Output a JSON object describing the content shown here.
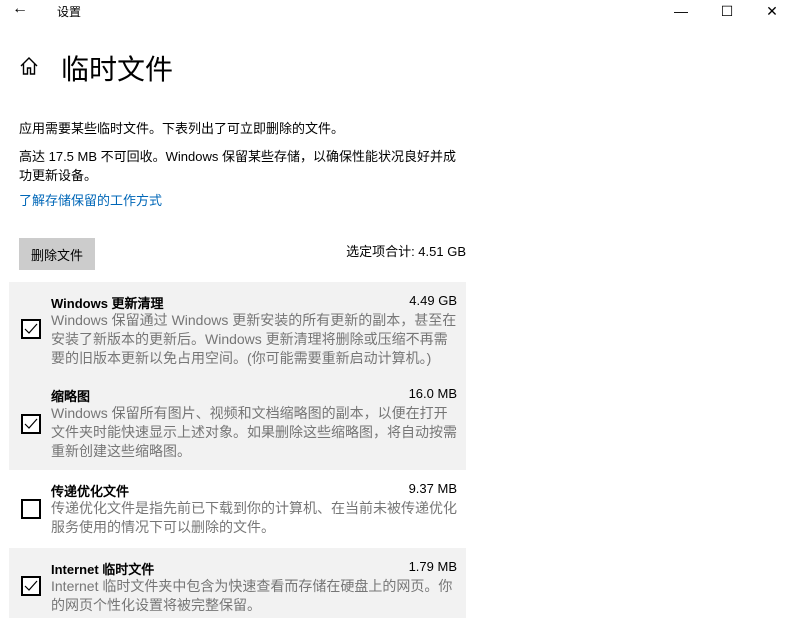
{
  "window": {
    "title": "设置",
    "back": "←",
    "minimize": "—",
    "maximize": "☐",
    "close": "✕"
  },
  "page": {
    "title": "临时文件"
  },
  "intro": "应用需要某些临时文件。下表列出了可立即删除的文件。",
  "reserved": "高达 17.5 MB 不可回收。Windows 保留某些存储，以确保性能状况良好并成功更新设备。",
  "learn_link": "了解存储保留的工作方式",
  "delete_button": "删除文件",
  "total": "选定项合计: 4.51 GB",
  "items": [
    {
      "title": "Windows 更新清理",
      "size": "4.49 GB",
      "checked": true,
      "desc": "Windows 保留通过 Windows 更新安装的所有更新的副本，甚至在安装了新版本的更新后。Windows 更新清理将删除或压缩不再需要的旧版本更新以免占用空间。(你可能需要重新启动计算机。)"
    },
    {
      "title": "缩略图",
      "size": "16.0 MB",
      "checked": true,
      "desc": "Windows 保留所有图片、视频和文档缩略图的副本，以便在打开文件夹时能快速显示上述对象。如果删除这些缩略图，将自动按需重新创建这些缩略图。"
    },
    {
      "title": "传递优化文件",
      "size": "9.37 MB",
      "checked": false,
      "desc": "传递优化文件是指先前已下载到你的计算机、在当前未被传递优化服务使用的情况下可以删除的文件。"
    },
    {
      "title": "Internet 临时文件",
      "size": "1.79 MB",
      "checked": true,
      "desc": "Internet 临时文件夹中包含为快速查看而存储在硬盘上的网页。你的网页个性化设置将被完整保留。"
    }
  ]
}
